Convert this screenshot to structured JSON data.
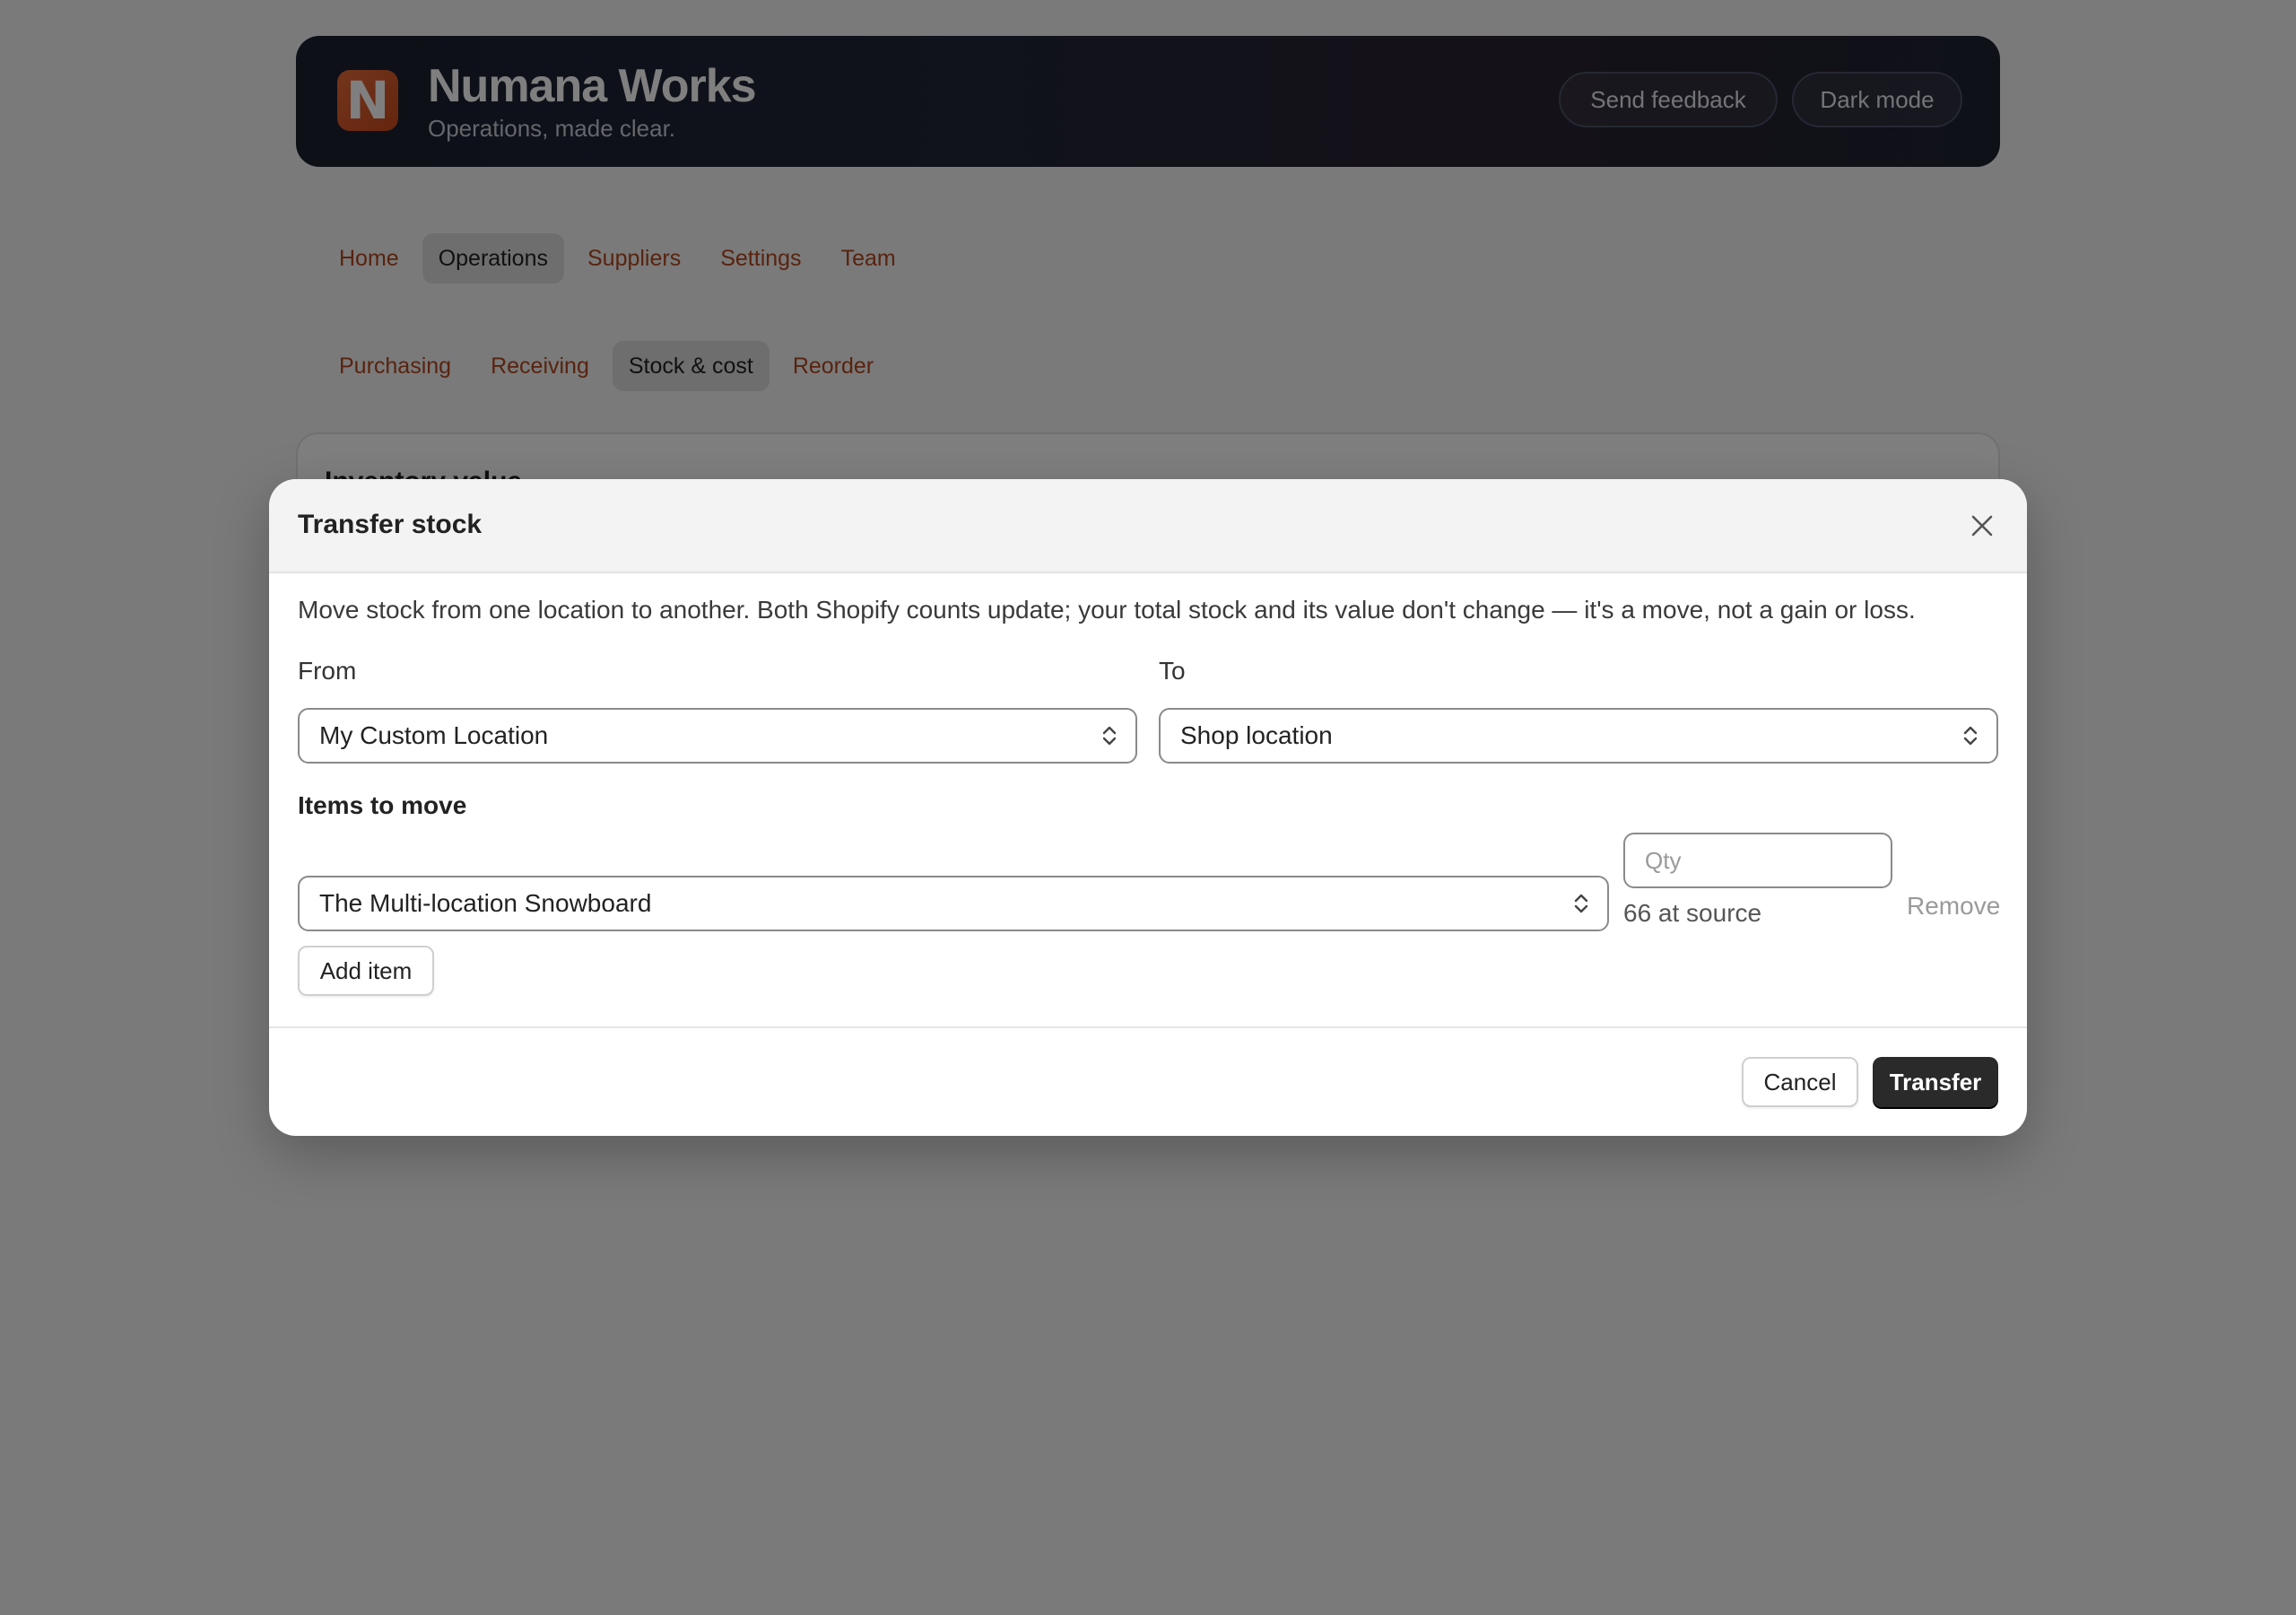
{
  "app": {
    "name": "Numana Works",
    "tagline": "Operations, made clear.",
    "logo_letter": "N"
  },
  "header": {
    "feedback_label": "Send feedback",
    "dark_mode_label": "Dark mode"
  },
  "nav": {
    "items": [
      {
        "label": "Home"
      },
      {
        "label": "Operations",
        "active": true
      },
      {
        "label": "Suppliers"
      },
      {
        "label": "Settings"
      },
      {
        "label": "Team"
      }
    ]
  },
  "subnav": {
    "items": [
      {
        "label": "Purchasing"
      },
      {
        "label": "Receiving"
      },
      {
        "label": "Stock & cost",
        "active": true
      },
      {
        "label": "Reorder"
      }
    ]
  },
  "card": {
    "title": "Inventory value"
  },
  "modal": {
    "title": "Transfer stock",
    "description": "Move stock from one location to another. Both Shopify counts update; your total stock and its value don't change — it's a move, not a gain or loss.",
    "from_label": "From",
    "from_value": "My Custom Location",
    "to_label": "To",
    "to_value": "Shop location",
    "items_label": "Items to move",
    "item_value": "The Multi-location Snowboard",
    "qty_placeholder": "Qty",
    "at_source": "66 at source",
    "remove_label": "Remove",
    "add_item_label": "Add item",
    "cancel_label": "Cancel",
    "transfer_label": "Transfer"
  },
  "colors": {
    "accent": "#b0461e",
    "header_bg": "#1c2030",
    "logo": "#e0602e",
    "primary_button": "#2a2a2a"
  }
}
